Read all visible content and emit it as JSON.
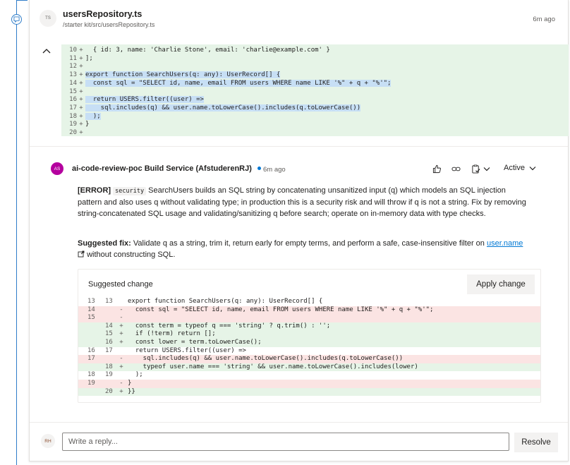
{
  "file": {
    "badge": "TS",
    "name": "usersRepository.ts",
    "path": "/starter kit/src/usersRepository.ts",
    "time": "6m ago"
  },
  "diff_context": [
    {
      "num": "10",
      "sign": "+",
      "code": "  { id: 3, name: 'Charlie Stone', email: 'charlie@example.com' }",
      "hl": false
    },
    {
      "num": "11",
      "sign": "+",
      "code": "];",
      "hl": false
    },
    {
      "num": "12",
      "sign": "+",
      "code": "",
      "hl": false
    },
    {
      "num": "13",
      "sign": "+",
      "code": "export function SearchUsers(q: any): UserRecord[] {",
      "hl": true
    },
    {
      "num": "14",
      "sign": "+",
      "code": "  const sql = \"SELECT id, name, email FROM users WHERE name LIKE '%\" + q + \"%'\";",
      "hl": true
    },
    {
      "num": "15",
      "sign": "+",
      "code": "",
      "hl": false
    },
    {
      "num": "16",
      "sign": "+",
      "code": "  return USERS.filter((user) =>",
      "hl": true
    },
    {
      "num": "17",
      "sign": "+",
      "code": "    sql.includes(q) && user.name.toLowerCase().includes(q.toLowerCase())",
      "hl": true
    },
    {
      "num": "18",
      "sign": "+",
      "code": "  );",
      "hl": true
    },
    {
      "num": "19",
      "sign": "+",
      "code": "}",
      "hl": false
    },
    {
      "num": "20",
      "sign": "+",
      "code": "",
      "hl": false
    }
  ],
  "comment": {
    "avatar": "AS",
    "author": "ai-code-review-poc Build Service (AfstuderenRJ)",
    "time": "6m ago",
    "status": "Active",
    "error_tag": "[ERROR]",
    "error_code": "security",
    "error_text": "SearchUsers builds an SQL string by concatenating unsanitized input (q) which models an SQL injection pattern and also uses q without validating type; in production this is a security risk and will throw if q is not a string. Fix by removing string-concatenated SQL usage and validating/sanitizing q before search; operate on in-memory data with type checks.",
    "fix_label": "Suggested fix:",
    "fix_text": "Validate q as a string, trim it, return early for empty terms, and perform a safe, case-insensitive filter on",
    "fix_link": "user.name",
    "fix_tail": "without constructing SQL."
  },
  "suggested_change": {
    "title": "Suggested change",
    "apply_label": "Apply change",
    "lines": [
      {
        "old": "13",
        "new": "13",
        "sign": "",
        "type": "ctx",
        "code": "export function SearchUsers(q: any): UserRecord[] {"
      },
      {
        "old": "14",
        "new": "",
        "sign": "-",
        "type": "del",
        "code": "  const sql = \"SELECT id, name, email FROM users WHERE name LIKE '%\" + q + \"%'\";"
      },
      {
        "old": "15",
        "new": "",
        "sign": "-",
        "type": "del",
        "code": ""
      },
      {
        "old": "",
        "new": "14",
        "sign": "+",
        "type": "add",
        "code": "  const term = typeof q === 'string' ? q.trim() : '';"
      },
      {
        "old": "",
        "new": "15",
        "sign": "+",
        "type": "add",
        "code": "  if (!term) return [];"
      },
      {
        "old": "",
        "new": "16",
        "sign": "+",
        "type": "add",
        "code": "  const lower = term.toLowerCase();"
      },
      {
        "old": "16",
        "new": "17",
        "sign": "",
        "type": "ctx",
        "code": "  return USERS.filter((user) =>"
      },
      {
        "old": "17",
        "new": "",
        "sign": "-",
        "type": "del",
        "code": "    sql.includes(q) && user.name.toLowerCase().includes(q.toLowerCase())"
      },
      {
        "old": "",
        "new": "18",
        "sign": "+",
        "type": "add",
        "code": "    typeof user.name === 'string' && user.name.toLowerCase().includes(lower)"
      },
      {
        "old": "18",
        "new": "19",
        "sign": "",
        "type": "ctx",
        "code": "  );"
      },
      {
        "old": "19",
        "new": "",
        "sign": "-",
        "type": "del",
        "code": "}"
      },
      {
        "old": "",
        "new": "20",
        "sign": "+",
        "type": "add",
        "code": "}}"
      }
    ]
  },
  "reply": {
    "avatar": "RH",
    "placeholder": "Write a reply...",
    "resolve_label": "Resolve"
  }
}
